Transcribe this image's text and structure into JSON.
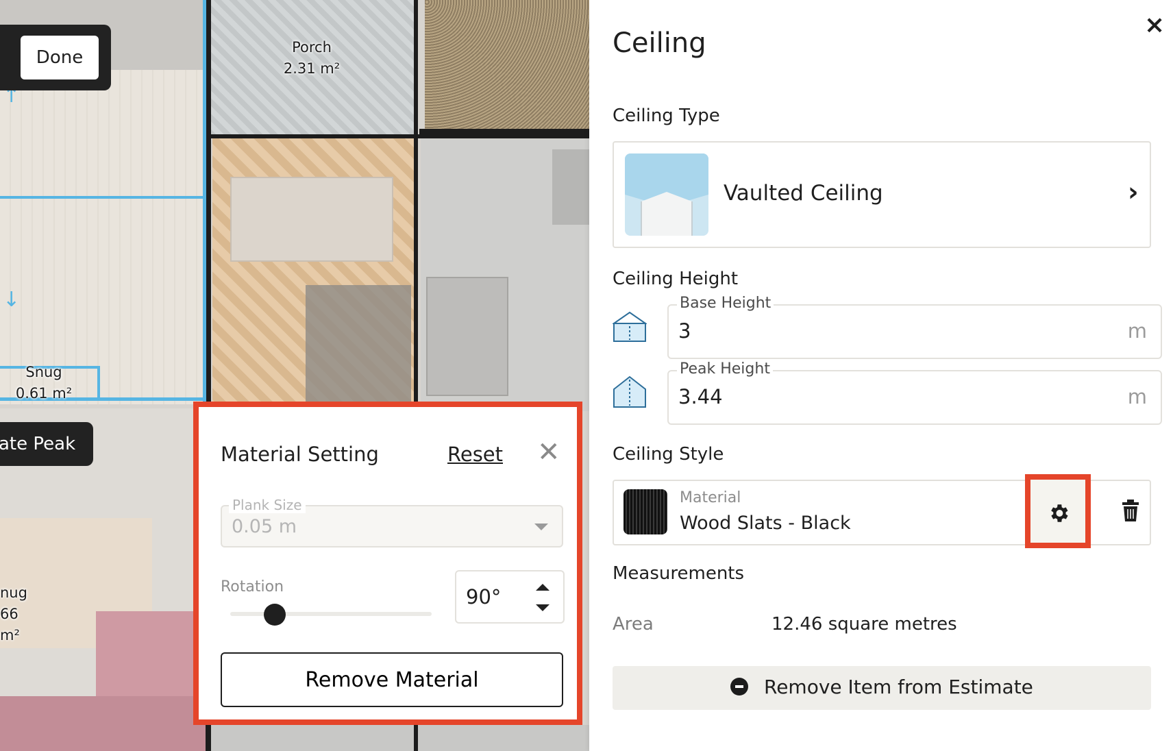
{
  "canvas": {
    "done_button": "Done",
    "create_peak_button": "ate Peak",
    "rooms": [
      {
        "name": "Porch",
        "area": "2.31 m²"
      },
      {
        "name": "Snug",
        "area": "0.61 m²"
      },
      {
        "name": "nug",
        "area": "66 m²"
      }
    ]
  },
  "material_popup": {
    "title": "Material Setting",
    "reset_label": "Reset",
    "close_icon": "close-icon",
    "plank_size": {
      "label": "Plank Size",
      "value": "0.05 m"
    },
    "rotation": {
      "label": "Rotation",
      "value": "90°",
      "slider_fraction": 0.22
    },
    "remove_button": "Remove Material"
  },
  "panel": {
    "title": "Ceiling",
    "close_symbol": "×",
    "ceiling_type": {
      "heading": "Ceiling Type",
      "name": "Vaulted Ceiling"
    },
    "ceiling_height": {
      "heading": "Ceiling Height",
      "base": {
        "label": "Base Height",
        "value": "3",
        "unit": "m"
      },
      "peak": {
        "label": "Peak Height",
        "value": "3.44",
        "unit": "m"
      }
    },
    "ceiling_style": {
      "heading": "Ceiling Style",
      "material_label": "Material",
      "material_name": "Wood Slats - Black"
    },
    "measurements": {
      "heading": "Measurements",
      "area_label": "Area",
      "area_value": "12.46 square metres"
    },
    "remove_estimate_button": "Remove Item from Estimate"
  },
  "colors": {
    "highlight": "#e5452a",
    "wall_blue": "#56b5e3"
  }
}
